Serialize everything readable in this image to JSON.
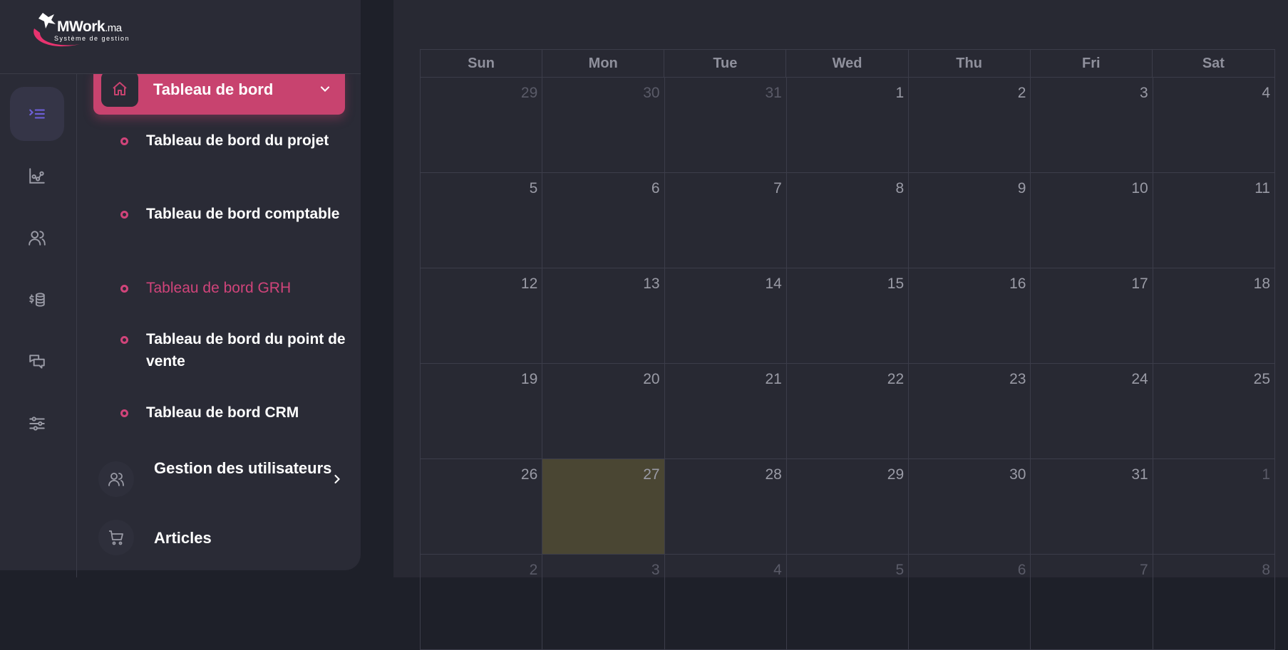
{
  "app": {
    "logo_main": "MWork",
    "logo_suffix": ".ma",
    "logo_tagline": "Système de gestion"
  },
  "rail": {
    "icons": [
      "menu-toggle-icon",
      "chart-icon",
      "users-icon",
      "finance-icon",
      "chat-icon",
      "settings-sliders-icon"
    ]
  },
  "menu": {
    "active_label": "Tableau de bord",
    "sub_items": [
      {
        "label": "Tableau de bord du projet"
      },
      {
        "label": "Tableau de bord comptable"
      },
      {
        "label": "Tableau de bord GRH"
      },
      {
        "label": "Tableau de bord du point de vente"
      },
      {
        "label": "Tableau de bord CRM"
      }
    ],
    "groups": [
      {
        "label": "Gestion des utilisateurs"
      },
      {
        "label": "Articles"
      }
    ]
  },
  "colors": {
    "accent": "#c8436f",
    "today": "#4a4633"
  },
  "calendar": {
    "weekdays": [
      "Sun",
      "Mon",
      "Tue",
      "Wed",
      "Thu",
      "Fri",
      "Sat"
    ],
    "days": [
      "29",
      "30",
      "31",
      "1",
      "2",
      "3",
      "4",
      "5",
      "6",
      "7",
      "8",
      "9",
      "10",
      "11",
      "12",
      "13",
      "14",
      "15",
      "16",
      "17",
      "18",
      "19",
      "20",
      "21",
      "22",
      "23",
      "24",
      "25",
      "26",
      "27",
      "28",
      "29",
      "30",
      "31",
      "1",
      "2",
      "3",
      "4",
      "5",
      "6",
      "7",
      "8"
    ],
    "other_month_indices": [
      0,
      1,
      2,
      34,
      35,
      36,
      37,
      38,
      39,
      40,
      41
    ],
    "today_index": 29
  }
}
